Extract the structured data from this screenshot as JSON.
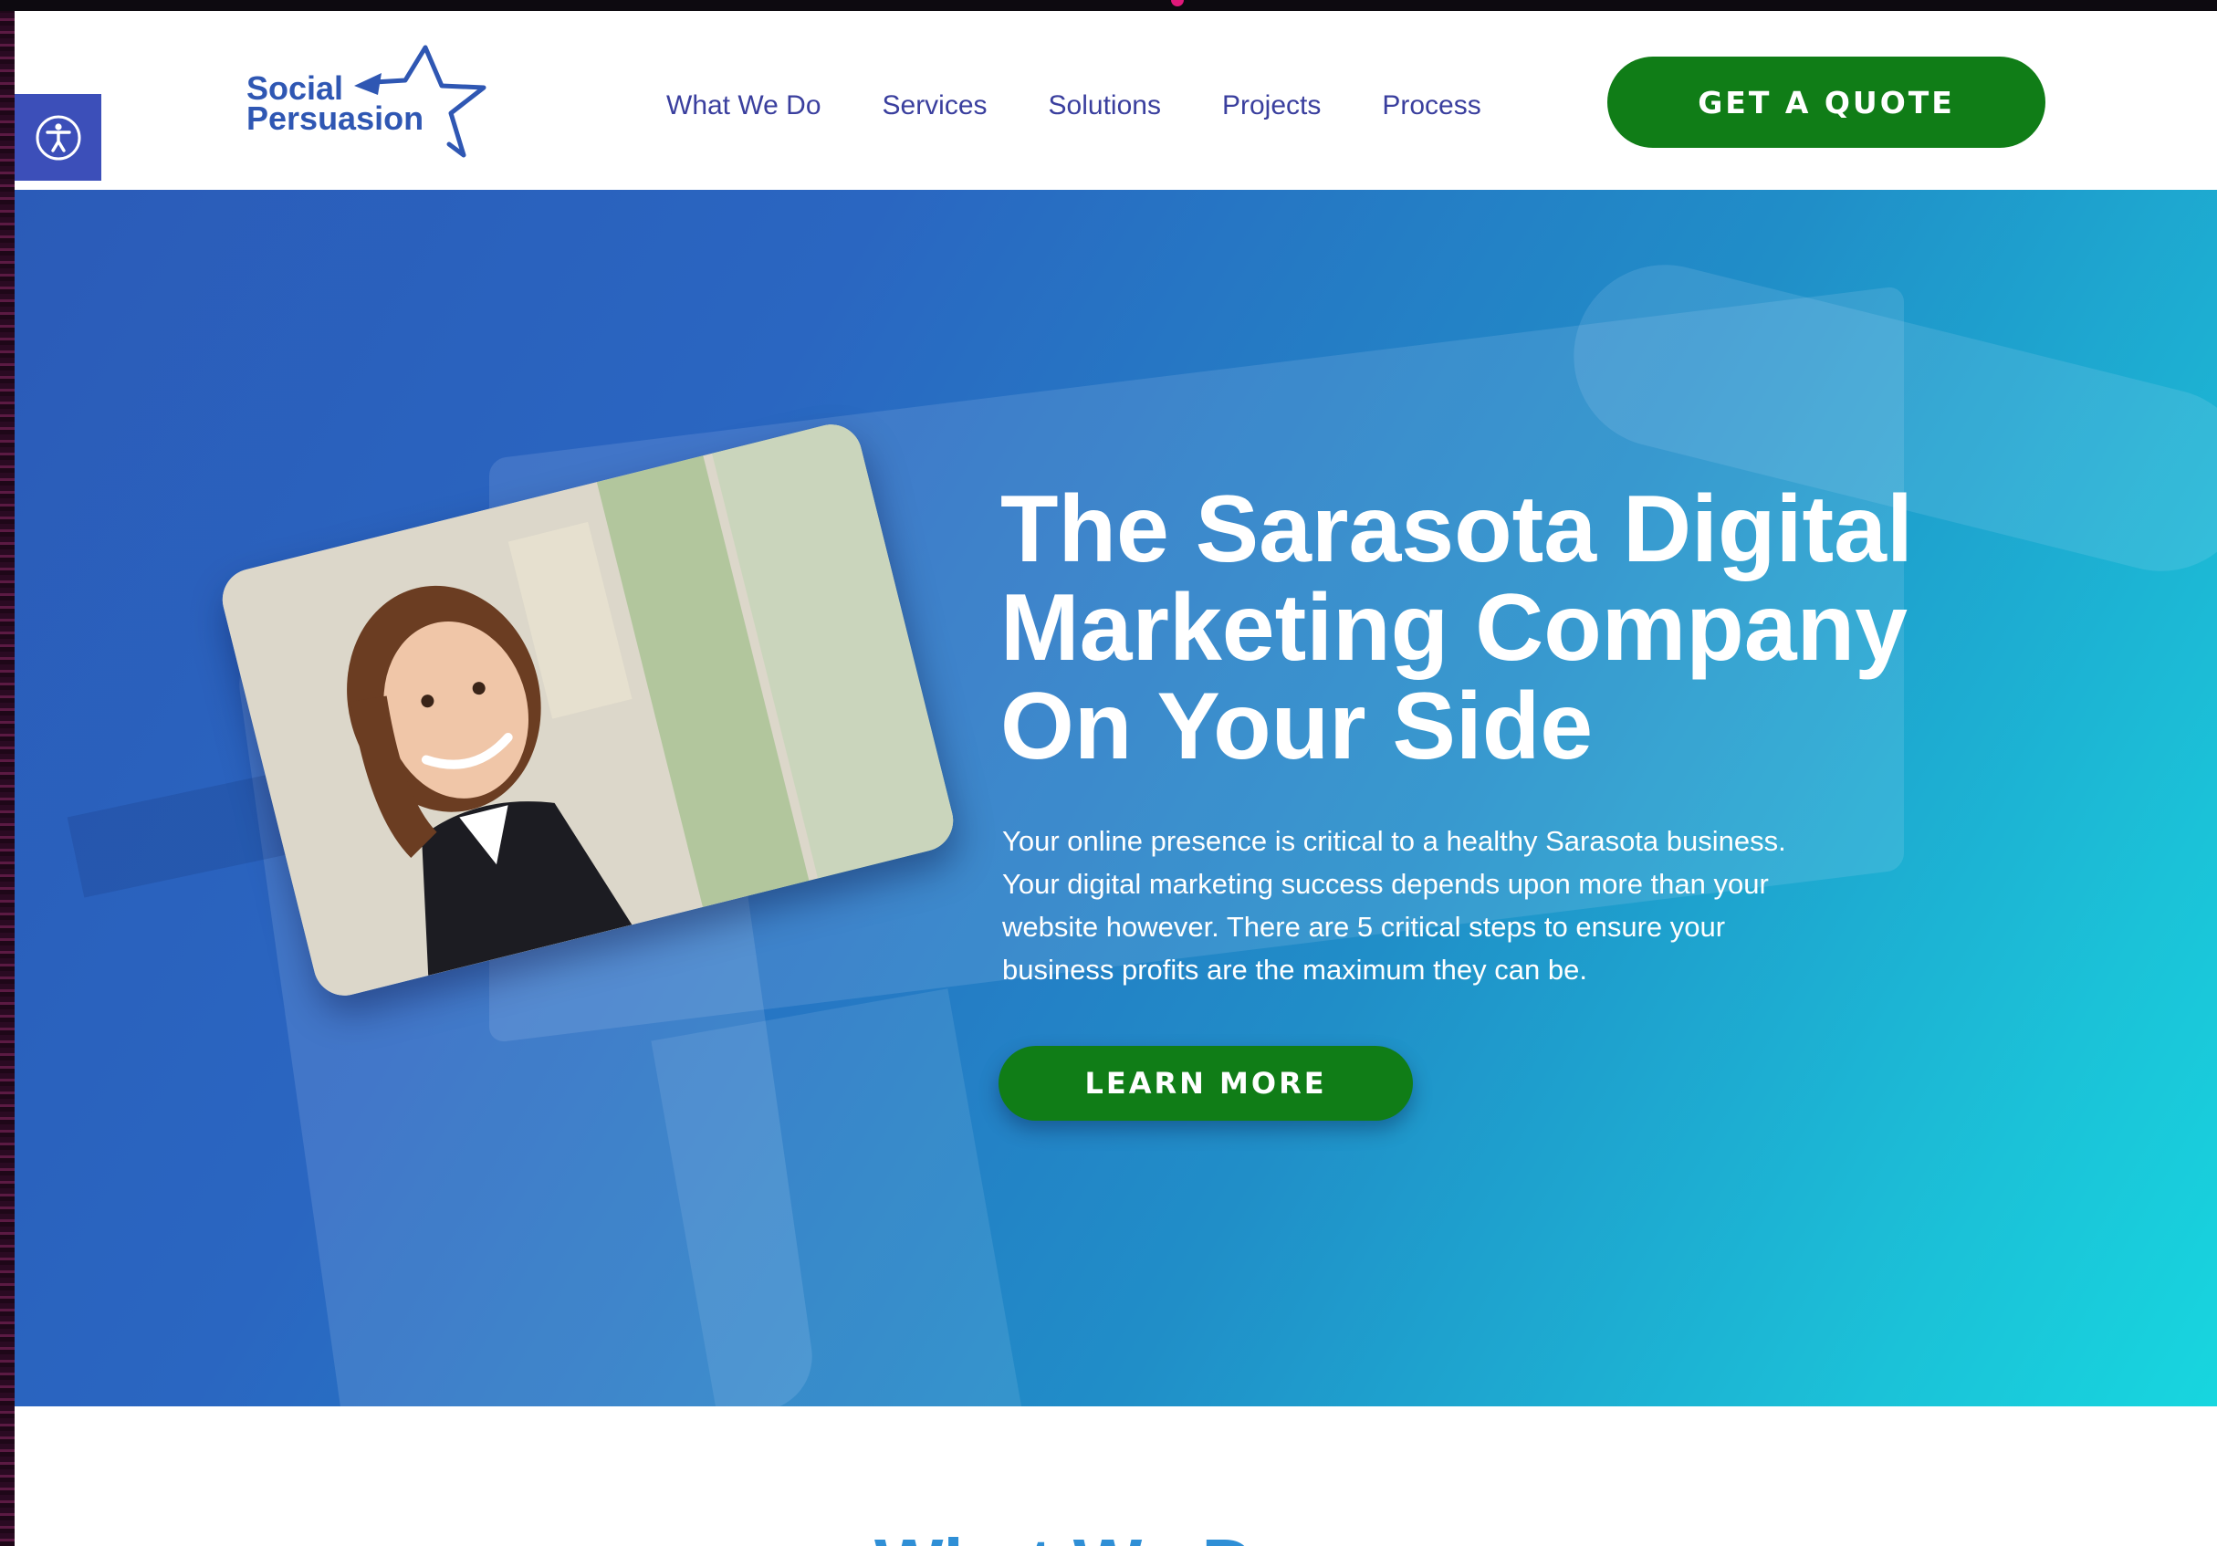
{
  "brand": {
    "logo_line1": "Social",
    "logo_line2": "Persuasion",
    "brand_color": "#2f57b3"
  },
  "accessibility": {
    "icon": "accessibility-person-icon",
    "color": "#3c4fb9"
  },
  "nav": {
    "items": [
      {
        "label": "What We Do"
      },
      {
        "label": "Services"
      },
      {
        "label": "Solutions"
      },
      {
        "label": "Projects"
      },
      {
        "label": "Process"
      }
    ],
    "cta_label": "GET A QUOTE",
    "cta_color": "#107d17"
  },
  "hero": {
    "title_lines": [
      "The Sarasota Digital",
      "Marketing Company",
      "On Your Side"
    ],
    "description_lines": [
      "Your online presence is critical to a healthy Sarasota business.",
      "Your digital marketing success depends upon more than your",
      "website however. There are 5 critical steps to ensure your",
      "business profits are the maximum they can be."
    ],
    "button_label": "LEARN MORE",
    "gradient_start": "#2b5bb8",
    "gradient_end": "#17d6df"
  },
  "next_section": {
    "heading": "What We Do"
  }
}
